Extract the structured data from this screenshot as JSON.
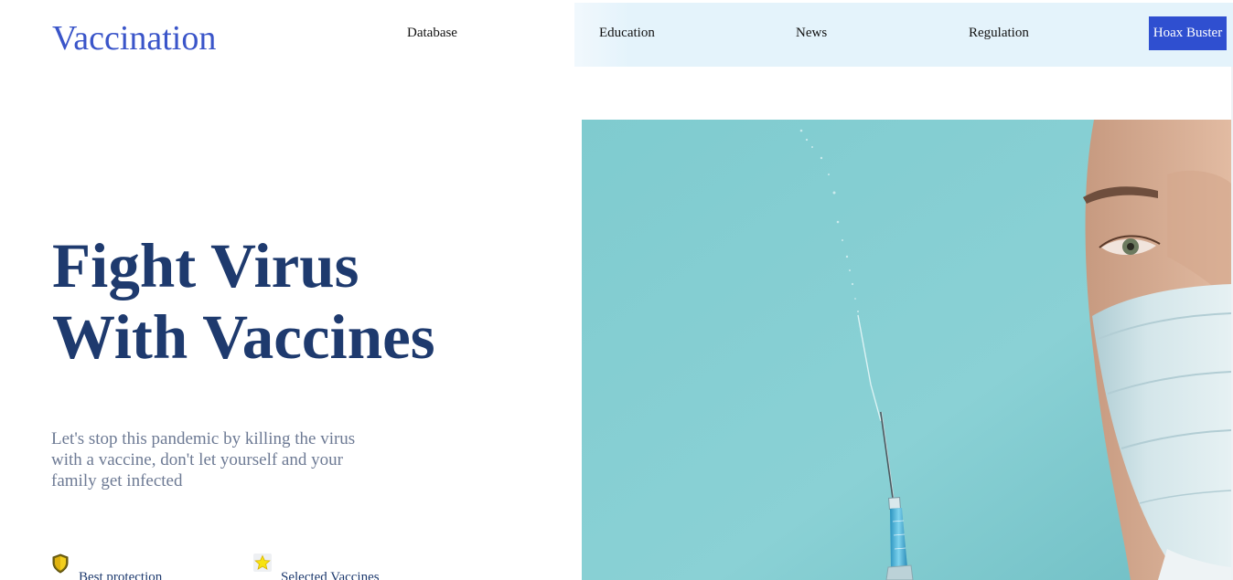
{
  "header": {
    "logo": "Vaccination",
    "nav": [
      {
        "label": "Database"
      },
      {
        "label": "Education"
      },
      {
        "label": "News"
      },
      {
        "label": "Regulation"
      }
    ],
    "cta_label": "Hoax Buster"
  },
  "hero": {
    "title_line1": "Fight Virus",
    "title_line2": "With Vaccines",
    "subtitle": "Let's stop this pandemic by killing the virus with a vaccine, don't let yourself and your family get infected",
    "features": [
      {
        "icon": "shield-icon",
        "label": "Best protection"
      },
      {
        "icon": "star-icon",
        "label": "Selected Vaccines"
      }
    ],
    "image": {
      "icon": "doctor-syringe-photo",
      "background_color": "#85cdd1"
    }
  },
  "colors": {
    "brand": "#3a55c9",
    "cta": "#2f4fd0",
    "heading": "#1e3a6e",
    "subtext": "#6d7a94",
    "nav_band": "#e4f3fb"
  }
}
